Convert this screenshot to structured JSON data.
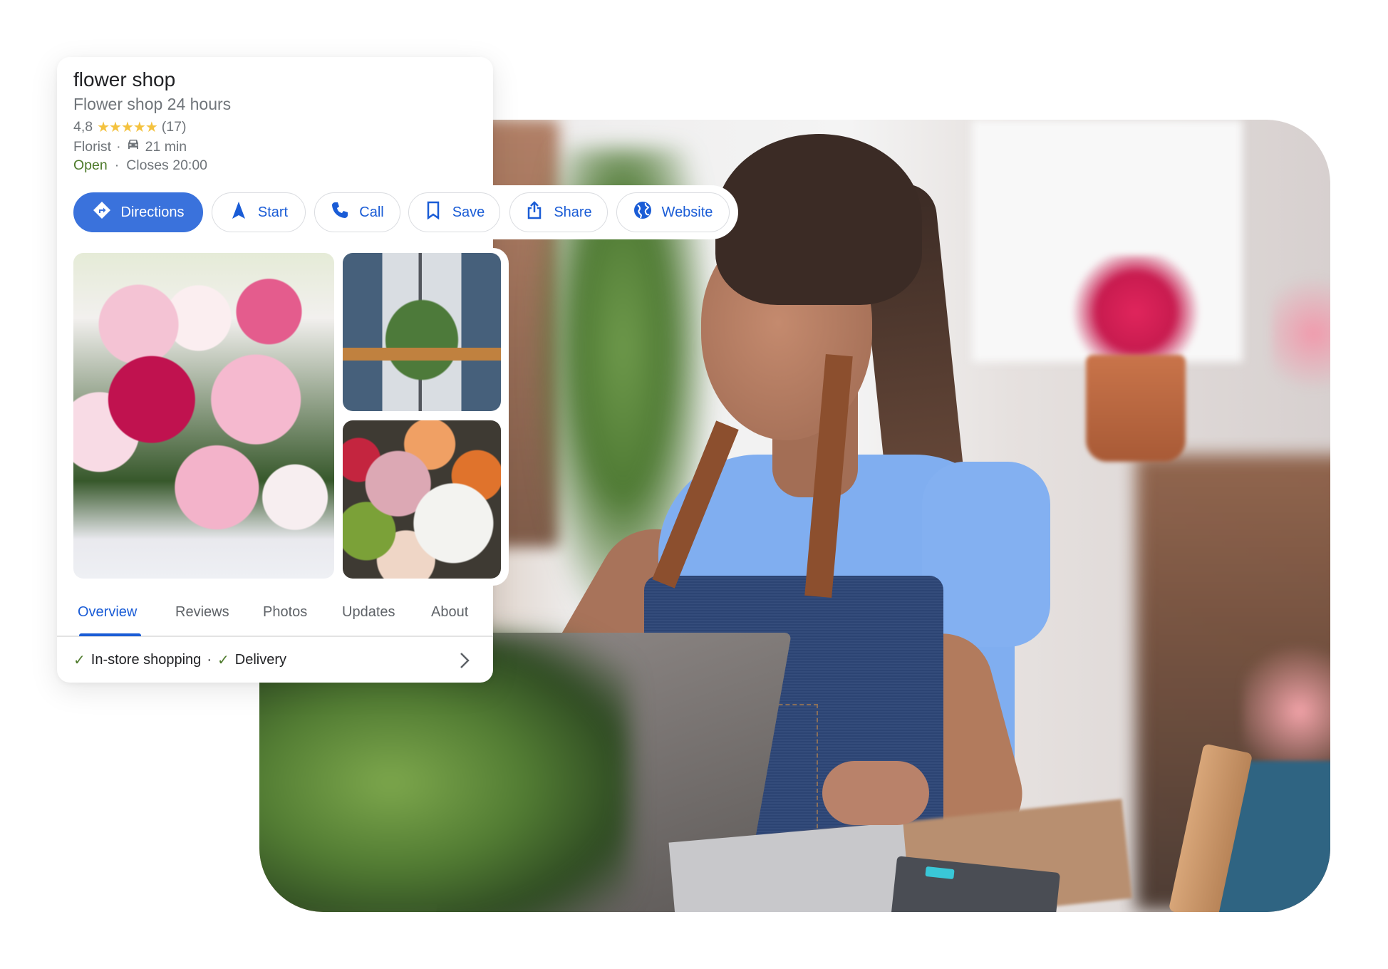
{
  "place": {
    "name": "flower shop",
    "subtitle": "Flower shop 24 hours",
    "rating": "4,8",
    "stars": "★★★★★",
    "review_count": "(17)",
    "category": "Florist",
    "separator": "·",
    "drive_icon": "car-icon",
    "drive_time": "21 min",
    "status": "Open",
    "status_color": "#4d7a2a",
    "closing": "Closes 20:00"
  },
  "actions": [
    {
      "label": "Directions",
      "icon": "directions-icon"
    },
    {
      "label": "Start",
      "icon": "navigation-arrow-icon"
    },
    {
      "label": "Call",
      "icon": "phone-icon"
    },
    {
      "label": "Save",
      "icon": "bookmark-icon"
    },
    {
      "label": "Share",
      "icon": "share-icon"
    },
    {
      "label": "Website",
      "icon": "globe-icon"
    }
  ],
  "photos": [
    {
      "description": "pink peony bouquet"
    },
    {
      "description": "window with flower box"
    },
    {
      "description": "flower shop display"
    }
  ],
  "tabs": [
    {
      "label": "Overview",
      "active": true
    },
    {
      "label": "Reviews"
    },
    {
      "label": "Photos"
    },
    {
      "label": "Updates"
    },
    {
      "label": "About"
    }
  ],
  "attributes": {
    "items": [
      "In-store shopping",
      "Delivery"
    ],
    "separator": "·",
    "check_icon": "checkmark-icon",
    "more_icon": "chevron-right-icon"
  },
  "hero_photo": {
    "description": "florist woman using laptop and calculator"
  },
  "colors": {
    "accent": "#3a72dc",
    "link": "#1a5cd6",
    "star": "#f4c23e",
    "muted_text": "#70757a"
  }
}
